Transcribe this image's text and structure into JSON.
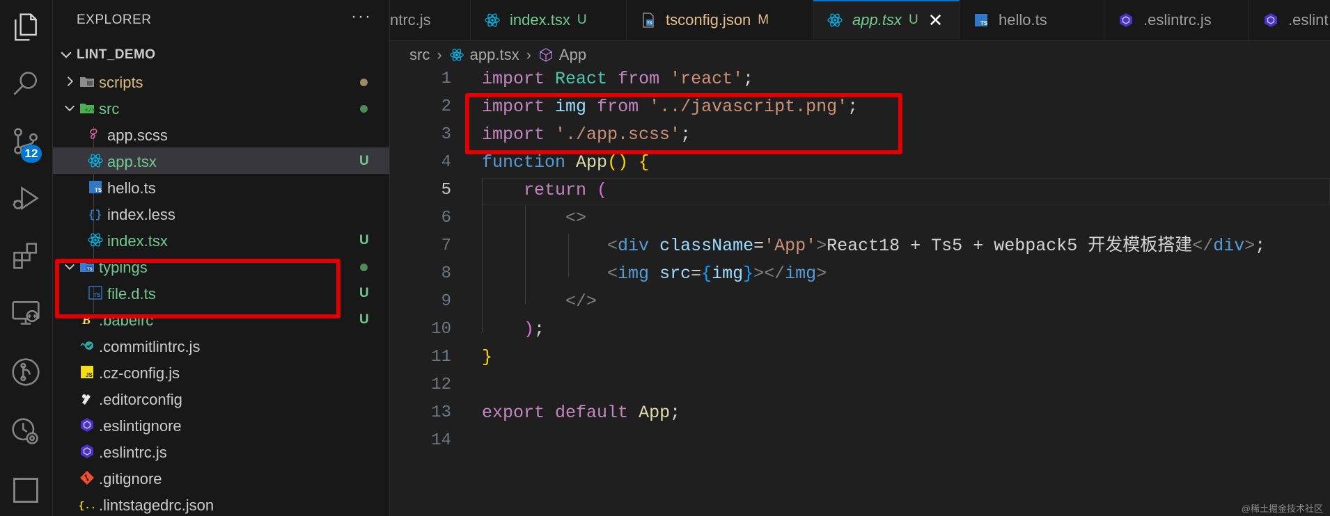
{
  "activity_bar": {
    "items": [
      {
        "name": "explorer-icon"
      },
      {
        "name": "search-icon"
      },
      {
        "name": "source-control-icon"
      },
      {
        "name": "run-debug-icon"
      },
      {
        "name": "extensions-icon"
      },
      {
        "name": "remote-explorer-icon"
      },
      {
        "name": "git-graph-icon"
      },
      {
        "name": "timeline-icon"
      },
      {
        "name": "panel-icon"
      }
    ],
    "scm_badge": "12"
  },
  "sidebar": {
    "title": "EXPLORER",
    "more": "···",
    "workspace": "LINT_DEMO",
    "tree": [
      {
        "label": "scripts",
        "kind": "folder-scripts",
        "expanded": false,
        "level": 0,
        "status": "",
        "dot": "#9b8b64",
        "color": "#d7ba7d"
      },
      {
        "label": "src",
        "kind": "folder-src",
        "expanded": true,
        "level": 0,
        "status": "",
        "dot": "#4f8a5a",
        "color": "#73c991"
      },
      {
        "label": "app.scss",
        "kind": "scss",
        "level": 1,
        "status": "",
        "color": "#cccccc"
      },
      {
        "label": "app.tsx",
        "kind": "react",
        "level": 1,
        "status": "U",
        "color": "#73c991",
        "selected": true
      },
      {
        "label": "hello.ts",
        "kind": "ts",
        "level": 1,
        "status": "",
        "color": "#cccccc"
      },
      {
        "label": "index.less",
        "kind": "less",
        "level": 1,
        "status": "",
        "color": "#cccccc"
      },
      {
        "label": "index.tsx",
        "kind": "react",
        "level": 1,
        "status": "U",
        "color": "#73c991"
      },
      {
        "label": "typings",
        "kind": "folder-ts",
        "expanded": true,
        "level": 0,
        "status": "",
        "dot": "#4f8a5a",
        "color": "#73c991"
      },
      {
        "label": "file.d.ts",
        "kind": "dts",
        "level": 1,
        "status": "U",
        "color": "#73c991"
      },
      {
        "label": ".babelrc",
        "kind": "babel",
        "level": 0,
        "status": "U",
        "color": "#73c991"
      },
      {
        "label": ".commitlintrc.js",
        "kind": "commitlint",
        "level": 0,
        "status": "",
        "color": "#cccccc"
      },
      {
        "label": ".cz-config.js",
        "kind": "js",
        "level": 0,
        "status": "",
        "color": "#cccccc"
      },
      {
        "label": ".editorconfig",
        "kind": "editorconfig",
        "level": 0,
        "status": "",
        "color": "#cccccc"
      },
      {
        "label": ".eslintignore",
        "kind": "eslint",
        "level": 0,
        "status": "",
        "color": "#cccccc"
      },
      {
        "label": ".eslintrc.js",
        "kind": "eslint",
        "level": 0,
        "status": "",
        "color": "#cccccc"
      },
      {
        "label": ".gitignore",
        "kind": "git",
        "level": 0,
        "status": "",
        "color": "#cccccc"
      },
      {
        "label": ".lintstagedrc.json",
        "kind": "json",
        "level": 0,
        "status": "",
        "color": "#cccccc"
      }
    ]
  },
  "tabs": [
    {
      "label": "ntrc.js",
      "kind": "none",
      "status": "",
      "color": "#9d9d9d"
    },
    {
      "label": "index.tsx",
      "kind": "react",
      "status": "U",
      "color": "#73c991"
    },
    {
      "label": "tsconfig.json",
      "kind": "tsconfig",
      "status": "M",
      "color": "#e2c08d"
    },
    {
      "label": "app.tsx",
      "kind": "react",
      "status": "U",
      "color": "#73c991",
      "active": true,
      "close": "✕"
    },
    {
      "label": "hello.ts",
      "kind": "ts",
      "status": "",
      "color": "#9d9d9d"
    },
    {
      "label": ".eslintrc.js",
      "kind": "eslint",
      "status": "",
      "color": "#9d9d9d"
    },
    {
      "label": ".eslint",
      "kind": "eslint",
      "status": "",
      "color": "#9d9d9d"
    }
  ],
  "breadcrumb": [
    "src",
    "app.tsx",
    "App"
  ],
  "editor": {
    "line_numbers": [
      "1",
      "2",
      "3",
      "4",
      "5",
      "6",
      "7",
      "8",
      "9",
      "10",
      "11",
      "12",
      "13",
      "14"
    ],
    "active_line": "5",
    "lines": [
      [
        [
          "kw",
          "import"
        ],
        [
          "plain",
          " "
        ],
        [
          "react",
          "React"
        ],
        [
          "plain",
          " "
        ],
        [
          "kw",
          "from"
        ],
        [
          "plain",
          " "
        ],
        [
          "str",
          "'react'"
        ],
        [
          "plain",
          ";"
        ]
      ],
      [
        [
          "kw",
          "import"
        ],
        [
          "plain",
          " "
        ],
        [
          "id",
          "img"
        ],
        [
          "plain",
          " "
        ],
        [
          "kw",
          "from"
        ],
        [
          "plain",
          " "
        ],
        [
          "str",
          "'../javascript.png'"
        ],
        [
          "plain",
          ";"
        ]
      ],
      [
        [
          "kw",
          "import"
        ],
        [
          "plain",
          " "
        ],
        [
          "str",
          "'./app.scss'"
        ],
        [
          "plain",
          ";"
        ]
      ],
      [
        [
          "kw2",
          "function"
        ],
        [
          "plain",
          " "
        ],
        [
          "fn",
          "App"
        ],
        [
          "br1",
          "()"
        ],
        [
          "plain",
          " "
        ],
        [
          "br1",
          "{"
        ]
      ],
      [
        [
          "plain",
          "    "
        ],
        [
          "kw",
          "return"
        ],
        [
          "plain",
          " "
        ],
        [
          "br2",
          "("
        ]
      ],
      [
        [
          "plain",
          "        "
        ],
        [
          "punc",
          "<>"
        ]
      ],
      [
        [
          "plain",
          "            "
        ],
        [
          "punc",
          "<"
        ],
        [
          "tag",
          "div"
        ],
        [
          "plain",
          " "
        ],
        [
          "id",
          "className"
        ],
        [
          "plain",
          "="
        ],
        [
          "str",
          "'App'"
        ],
        [
          "punc",
          ">"
        ],
        [
          "plain",
          "React18 + Ts5 + webpack5 开发模板搭建"
        ],
        [
          "punc",
          "</"
        ],
        [
          "tag",
          "div"
        ],
        [
          "punc",
          ">"
        ],
        [
          "plain",
          ";"
        ]
      ],
      [
        [
          "plain",
          "            "
        ],
        [
          "punc",
          "<"
        ],
        [
          "tag",
          "img"
        ],
        [
          "plain",
          " "
        ],
        [
          "id",
          "src"
        ],
        [
          "plain",
          "="
        ],
        [
          "bl",
          "{"
        ],
        [
          "id",
          "img"
        ],
        [
          "bl",
          "}"
        ],
        [
          "punc",
          "></"
        ],
        [
          "tag",
          "img"
        ],
        [
          "punc",
          ">"
        ]
      ],
      [
        [
          "plain",
          "        "
        ],
        [
          "punc",
          "</>"
        ]
      ],
      [
        [
          "plain",
          "    "
        ],
        [
          "br2",
          ")"
        ],
        [
          "plain",
          ";"
        ]
      ],
      [
        [
          "br1",
          "}"
        ]
      ],
      [],
      [
        [
          "kw",
          "export"
        ],
        [
          "plain",
          " "
        ],
        [
          "kw",
          "default"
        ],
        [
          "plain",
          " "
        ],
        [
          "fn",
          "App"
        ],
        [
          "plain",
          ";"
        ]
      ],
      []
    ]
  },
  "watermark": "@稀土掘金技术社区"
}
